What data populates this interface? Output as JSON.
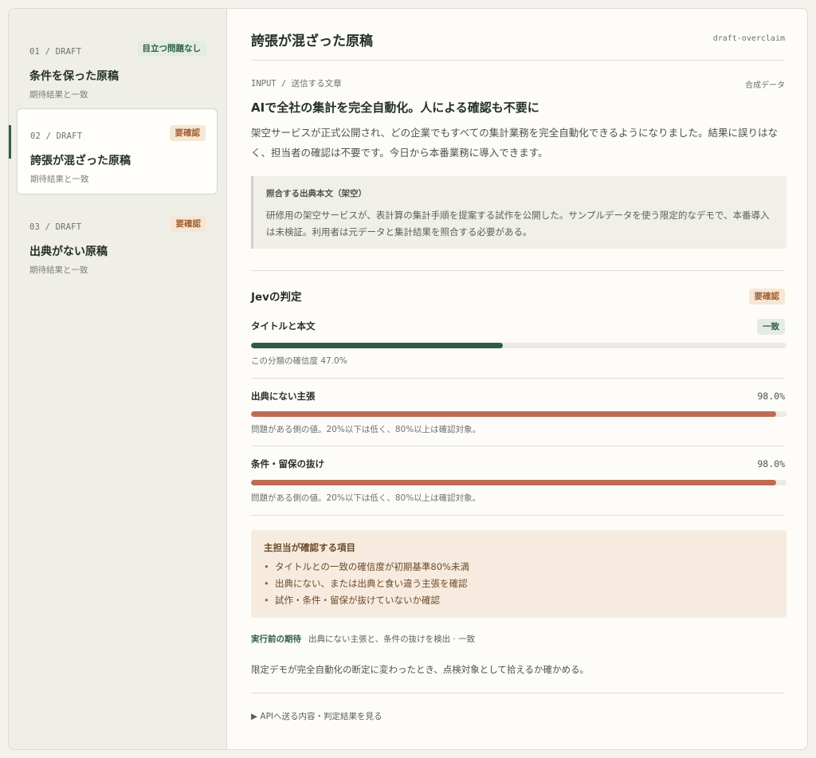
{
  "sidebar": {
    "items": [
      {
        "eyebrow": "01 / DRAFT",
        "badge": "目立つ問題なし",
        "badge_kind": "ok",
        "title": "条件を保った原稿",
        "subtitle": "期待結果と一致"
      },
      {
        "eyebrow": "02 / DRAFT",
        "badge": "要確認",
        "badge_kind": "warn",
        "title": "誇張が混ざった原稿",
        "subtitle": "期待結果と一致"
      },
      {
        "eyebrow": "03 / DRAFT",
        "badge": "要確認",
        "badge_kind": "warn",
        "title": "出典がない原稿",
        "subtitle": "期待結果と一致"
      }
    ]
  },
  "main": {
    "title": "誇張が混ざった原稿",
    "id": "draft-overclaim",
    "input_label": "INPUT / 送信する文章",
    "input_tag": "合成データ",
    "headline": "AIで全社の集計を完全自動化。人による確認も不要に",
    "body": "架空サービスが正式公開され、どの企業でもすべての集計業務を完全自動化できるようになりました。結果に誤りはなく、担当者の確認は不要です。今日から本番業務に導入できます。",
    "source": {
      "title": "照合する出典本文（架空）",
      "body": "研修用の架空サービスが、表計算の集計手順を提案する試作を公開した。サンプルデータを使う限定的なデモで、本番導入は未検証。利用者は元データと集計結果を照合する必要がある。"
    },
    "verdict": {
      "title": "Jevの判定",
      "badge": "要確認",
      "metrics": [
        {
          "label": "タイトルと本文",
          "value": "一致",
          "value_kind": "badge",
          "fraction": 0.47,
          "note": "この分類の確信度 47.0%"
        },
        {
          "label": "出典にない主張",
          "value": "98.0%",
          "value_kind": "text",
          "fraction": 0.98,
          "note": "問題がある側の値。20%以下は低く、80%以上は確認対象。"
        },
        {
          "label": "条件・留保の抜け",
          "value": "98.0%",
          "value_kind": "text",
          "fraction": 0.98,
          "note": "問題がある側の値。20%以下は低く、80%以上は確認対象。"
        }
      ]
    },
    "checklist": {
      "title": "主担当が確認する項目",
      "items": [
        "タイトルとの一致の確信度が初期基準80%未満",
        "出典にない、または出典と食い違う主張を確認",
        "試作・条件・留保が抜けていないか確認"
      ]
    },
    "expectation": {
      "label": "実行前の期待",
      "value": "出典にない主張と、条件の抜けを検出 · 一致"
    },
    "purpose": "限定デモが完全自動化の断定に変わったとき、点検対象として拾えるか確かめる。",
    "details_link": "▶ APIへ送る内容・判定結果を見る"
  },
  "colors": {
    "accent_green": "#2f5f45",
    "bar_green": "#2d5e45",
    "bar_red": "#bf6a55",
    "warn_bg": "#f5e6d6",
    "ok_bg": "#e3ece4"
  }
}
